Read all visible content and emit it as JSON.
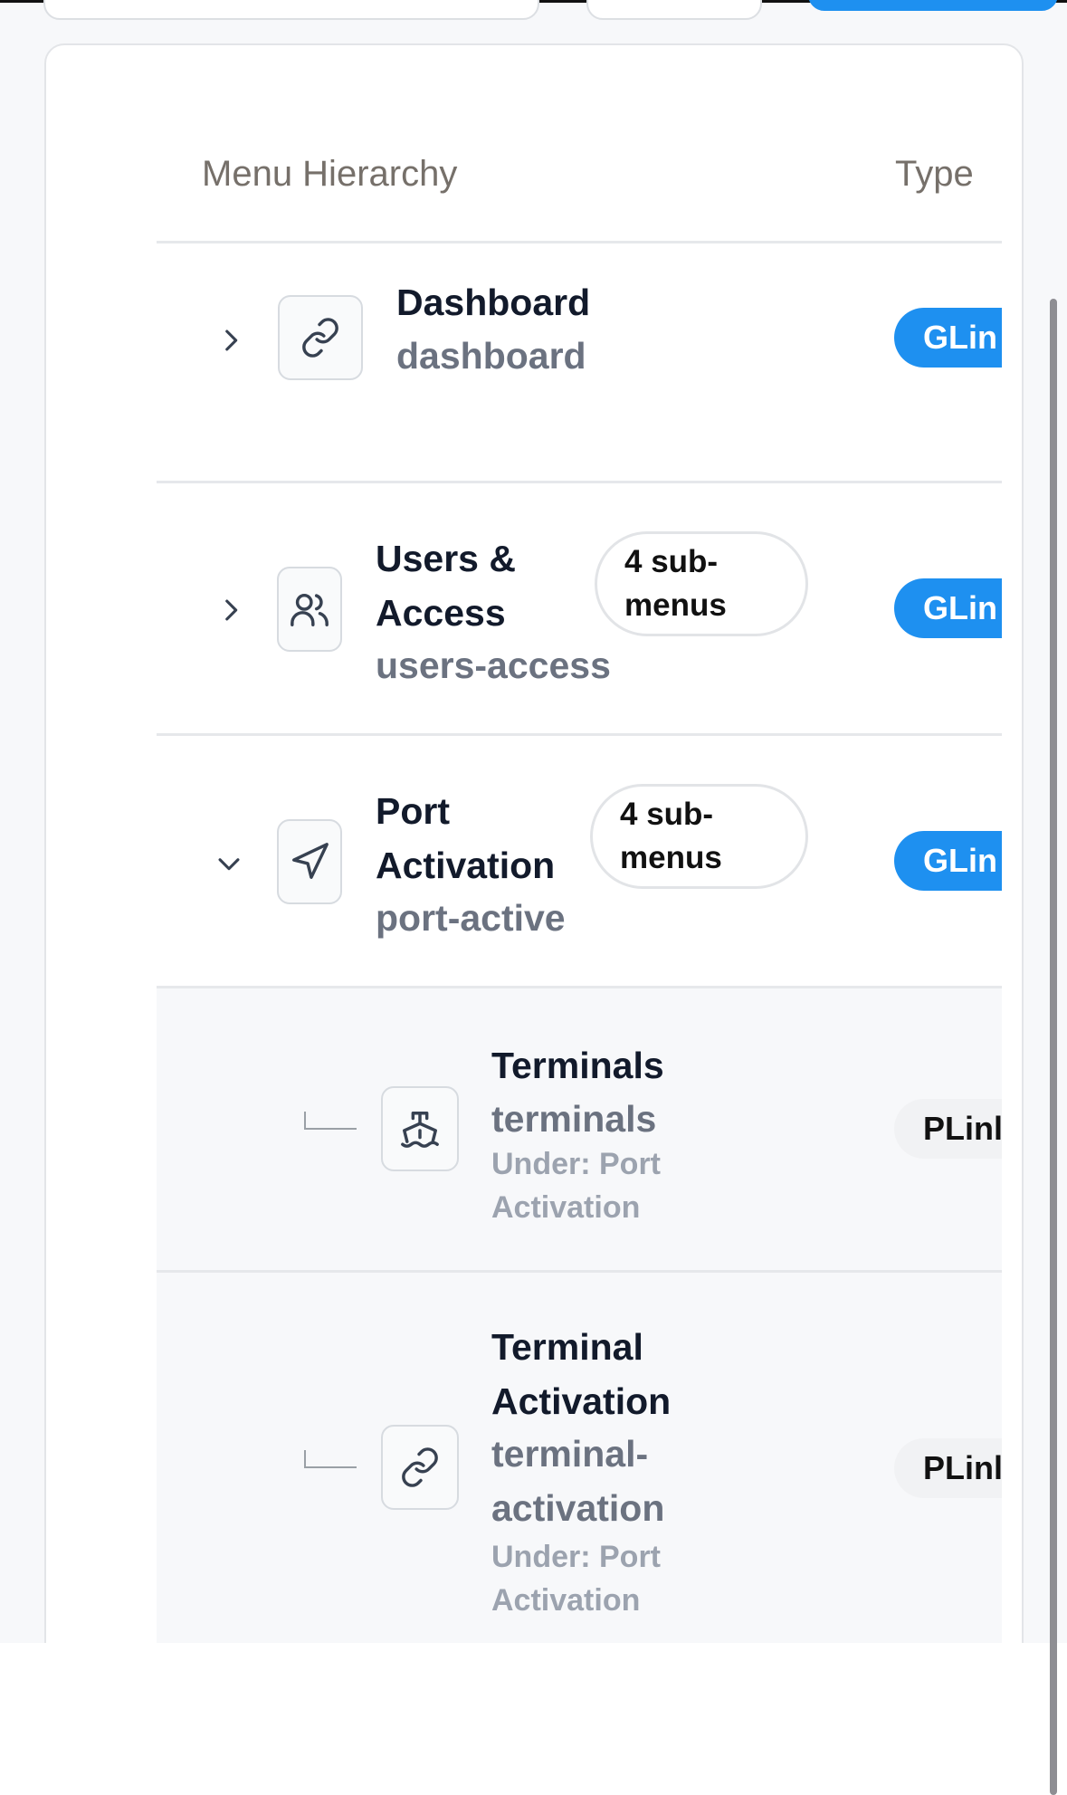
{
  "table": {
    "columns": {
      "hierarchy": "Menu Hierarchy",
      "type": "Type"
    },
    "rows": [
      {
        "title": "Dashboard",
        "slug": "dashboard",
        "icon": "link-icon",
        "type": "GLin",
        "expanded": false
      },
      {
        "title": "Users &\nAccess",
        "slug": "users-access",
        "icon": "users-icon",
        "submenus": "4 sub-\nmenus",
        "type": "GLin",
        "expanded": false
      },
      {
        "title": "Port\nActivation",
        "slug": "port-active",
        "icon": "navigation-arrow-icon",
        "submenus": "4 sub-\nmenus",
        "type": "GLin",
        "expanded": true
      },
      {
        "title": "Terminals",
        "slug": "terminals",
        "parent": "Under: Port\nActivation",
        "icon": "ship-icon",
        "type": "PLinl",
        "child": true
      },
      {
        "title": "Terminal\nActivation",
        "slug": "terminal-\nactivation",
        "parent": "Under: Port\nActivation",
        "icon": "link-icon",
        "type": "PLinl",
        "child": true
      }
    ]
  },
  "colors": {
    "accent": "#1e90f0",
    "child_row_bg": "#f7f8fa"
  }
}
